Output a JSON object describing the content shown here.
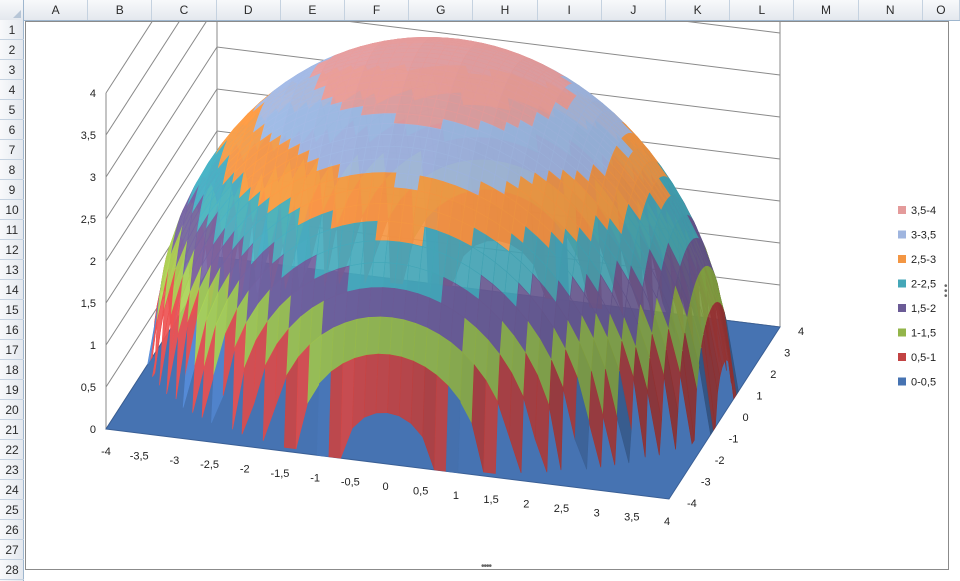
{
  "spreadsheet": {
    "columns": [
      "A",
      "B",
      "C",
      "D",
      "E",
      "F",
      "G",
      "H",
      "I",
      "J",
      "K",
      "L",
      "M",
      "N",
      "O"
    ],
    "rows": [
      "1",
      "2",
      "3",
      "4",
      "5",
      "6",
      "7",
      "8",
      "9",
      "10",
      "11",
      "12",
      "13",
      "14",
      "15",
      "16",
      "17",
      "18",
      "19",
      "20",
      "21",
      "22",
      "23",
      "24",
      "25",
      "26",
      "27",
      "28"
    ]
  },
  "chart_data": {
    "type": "surface",
    "z_axis": {
      "ticks": [
        "0",
        "0,5",
        "1",
        "1,5",
        "2",
        "2,5",
        "3",
        "3,5",
        "4"
      ],
      "range": [
        0,
        4
      ]
    },
    "x_axis": {
      "ticks": [
        "-4",
        "-3,5",
        "-3",
        "-2,5",
        "-2",
        "-1,5",
        "-1",
        "-0,5",
        "0",
        "0,5",
        "1",
        "1,5",
        "2",
        "2,5",
        "3",
        "3,5",
        "4"
      ],
      "range": [
        -4,
        4
      ]
    },
    "y_axis": {
      "ticks": [
        "4",
        "3",
        "2",
        "1",
        "0",
        "-1",
        "-2",
        "-3",
        "-4"
      ],
      "range": [
        -4,
        4
      ]
    },
    "legend_position": "right",
    "legend": [
      {
        "label": "3,5-4",
        "color": "#e49b9b"
      },
      {
        "label": "3-3,5",
        "color": "#9fb5df"
      },
      {
        "label": "2,5-3",
        "color": "#f39643"
      },
      {
        "label": "2-2,5",
        "color": "#44a7b8"
      },
      {
        "label": "1,5-2",
        "color": "#6b5b96"
      },
      {
        "label": "1-1,5",
        "color": "#93b54a"
      },
      {
        "label": "0,5-1",
        "color": "#c24343"
      },
      {
        "label": "0-0,5",
        "color": "#4673b2"
      }
    ]
  }
}
